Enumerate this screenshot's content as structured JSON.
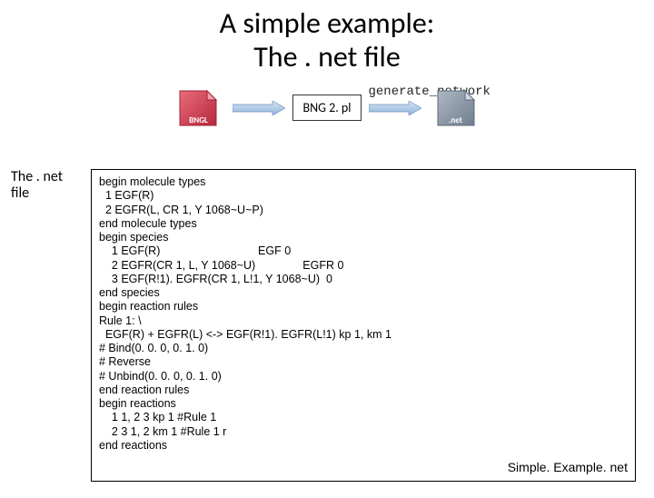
{
  "title": {
    "line1": "A simple example:",
    "line2_a": "The ",
    "line2_b": ". net",
    "line2_c": " file"
  },
  "flow": {
    "bngl_label": "BNGL",
    "bng2_label": "BNG 2. pl",
    "gen_label": "generate_network",
    "net_label": ".net"
  },
  "side": {
    "l1": "The . net",
    "l2": "file"
  },
  "code": [
    "begin molecule types",
    "  1 EGF(R)",
    "  2 EGFR(L, CR 1, Y 1068~U~P)",
    "end molecule types",
    "begin species",
    "    1 EGF(R)                               EGF 0",
    "    2 EGFR(CR 1, L, Y 1068~U)               EGFR 0",
    "    3 EGF(R!1). EGFR(CR 1, L!1, Y 1068~U)  0",
    "end species",
    "begin reaction rules",
    "Rule 1: \\",
    "  EGF(R) + EGFR(L) <-> EGF(R!1). EGFR(L!1) kp 1, km 1",
    "# Bind(0. 0. 0, 0. 1. 0)",
    "# Reverse",
    "# Unbind(0. 0. 0, 0. 1. 0)",
    "end reaction rules",
    "begin reactions",
    "    1 1, 2 3 kp 1 #Rule 1",
    "    2 3 1, 2 km 1 #Rule 1 r",
    "end reactions"
  ],
  "filename": "Simple. Example. net"
}
